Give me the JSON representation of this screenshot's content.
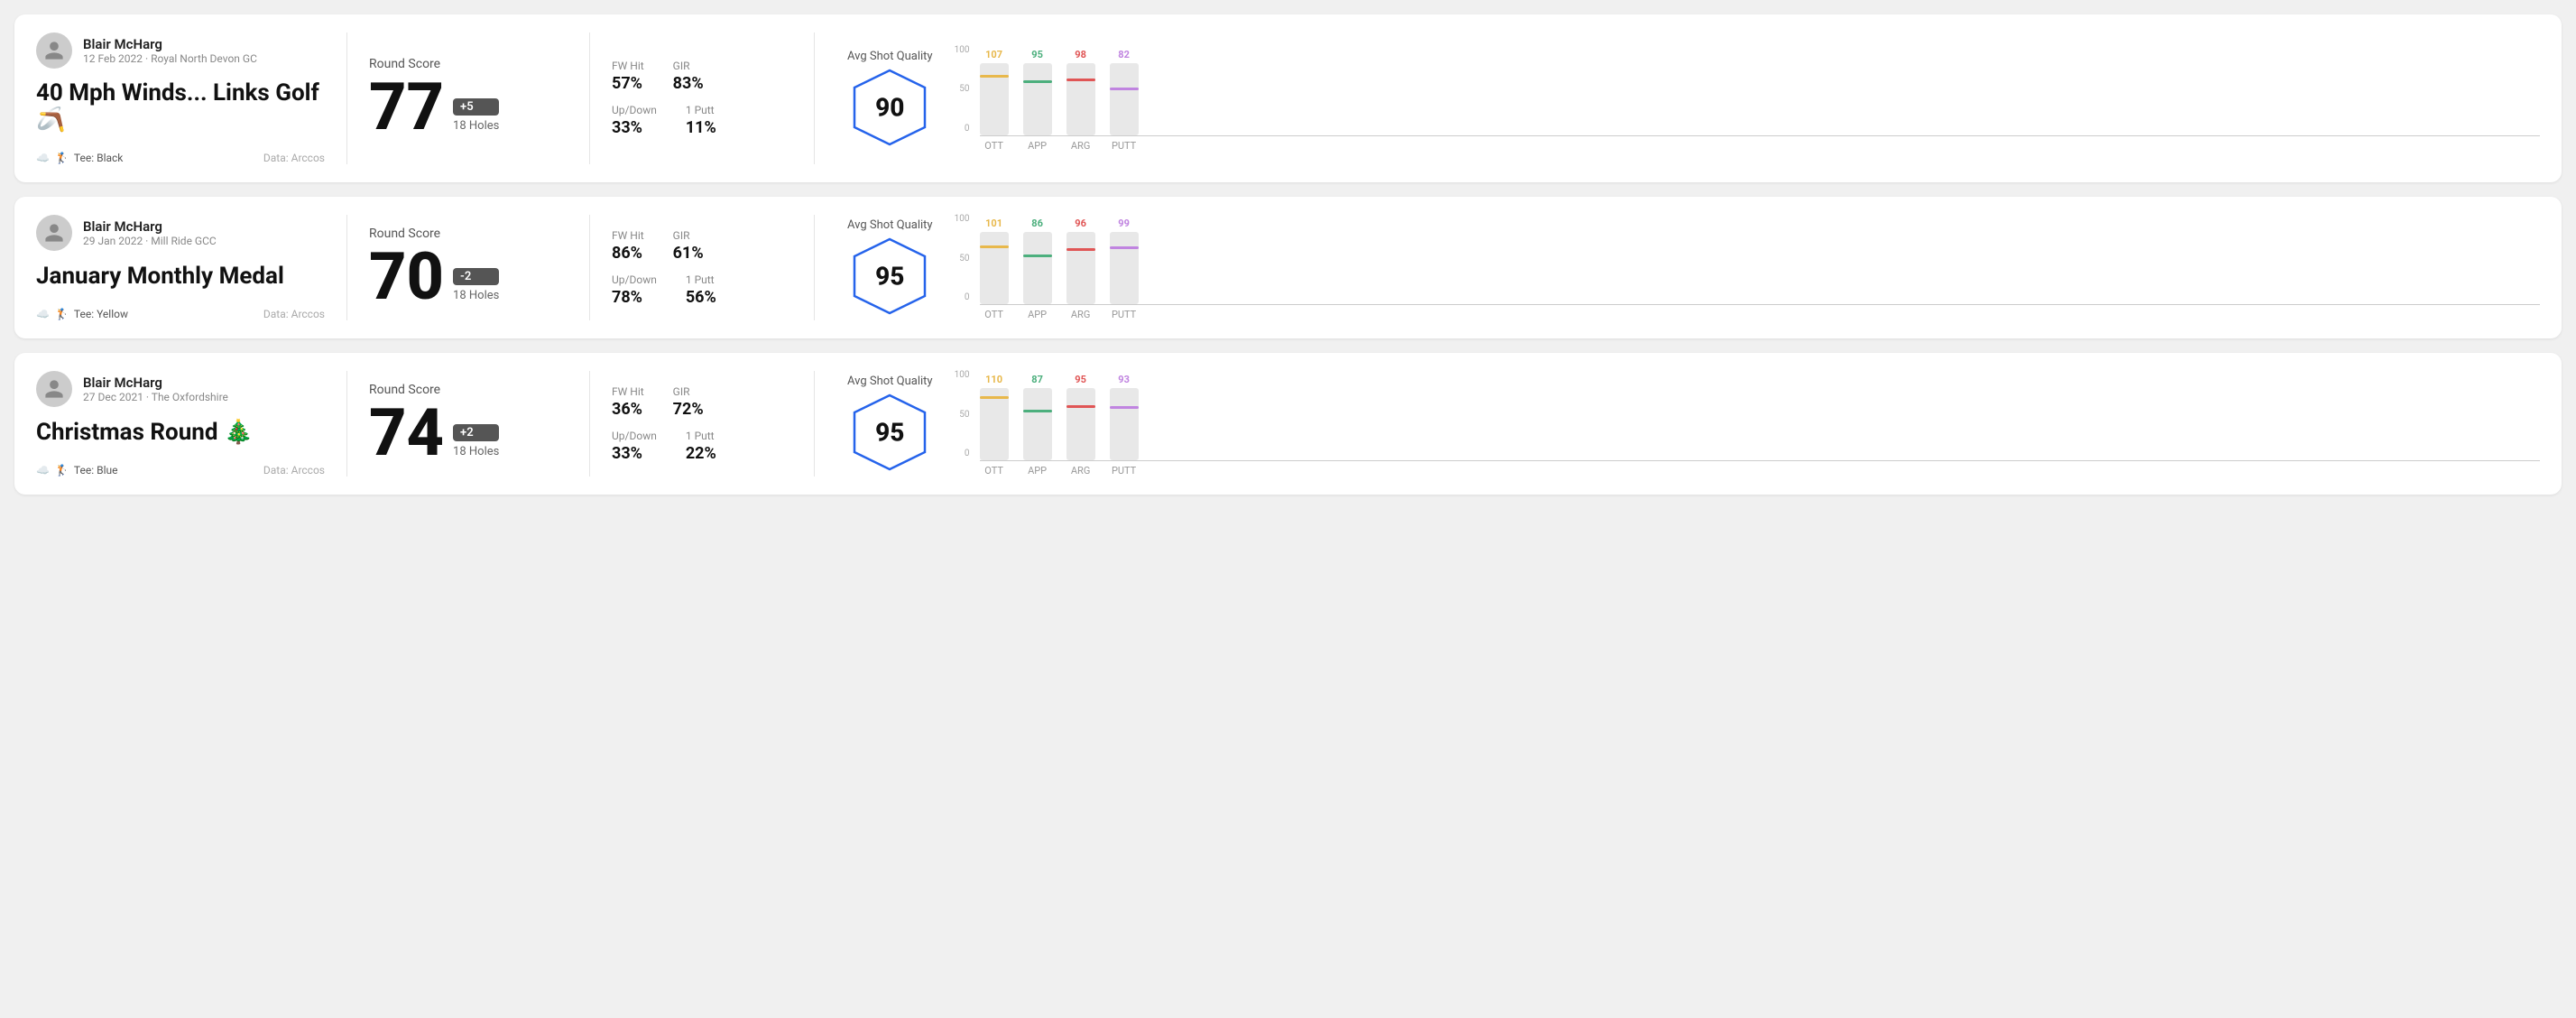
{
  "rounds": [
    {
      "id": "round-1",
      "user": {
        "name": "Blair McHarg",
        "meta": "12 Feb 2022 · Royal North Devon GC"
      },
      "title": "40 Mph Winds... Links Golf 🪃",
      "tee": "Black",
      "data_source": "Data: Arccos",
      "score": {
        "label": "Round Score",
        "number": "77",
        "badge": "+5",
        "badge_type": "over",
        "holes": "18 Holes"
      },
      "stats": [
        {
          "name": "FW Hit",
          "value": "57%"
        },
        {
          "name": "GIR",
          "value": "83%"
        },
        {
          "name": "Up/Down",
          "value": "33%"
        },
        {
          "name": "1 Putt",
          "value": "11%"
        }
      ],
      "quality": {
        "label": "Avg Shot Quality",
        "score": "90"
      },
      "chart": {
        "bars": [
          {
            "label": "OTT",
            "value": 107,
            "color": "#e8b84b",
            "pct": 80
          },
          {
            "label": "APP",
            "value": 95,
            "color": "#4caf7d",
            "pct": 72
          },
          {
            "label": "ARG",
            "value": 98,
            "color": "#e05555",
            "pct": 75
          },
          {
            "label": "PUTT",
            "value": 82,
            "color": "#c084e0",
            "pct": 62
          }
        ],
        "y_labels": [
          "100",
          "50",
          "0"
        ]
      }
    },
    {
      "id": "round-2",
      "user": {
        "name": "Blair McHarg",
        "meta": "29 Jan 2022 · Mill Ride GCC"
      },
      "title": "January Monthly Medal",
      "tee": "Yellow",
      "data_source": "Data: Arccos",
      "score": {
        "label": "Round Score",
        "number": "70",
        "badge": "-2",
        "badge_type": "under",
        "holes": "18 Holes"
      },
      "stats": [
        {
          "name": "FW Hit",
          "value": "86%"
        },
        {
          "name": "GIR",
          "value": "61%"
        },
        {
          "name": "Up/Down",
          "value": "78%"
        },
        {
          "name": "1 Putt",
          "value": "56%"
        }
      ],
      "quality": {
        "label": "Avg Shot Quality",
        "score": "95"
      },
      "chart": {
        "bars": [
          {
            "label": "OTT",
            "value": 101,
            "color": "#e8b84b",
            "pct": 78
          },
          {
            "label": "APP",
            "value": 86,
            "color": "#4caf7d",
            "pct": 65
          },
          {
            "label": "ARG",
            "value": 96,
            "color": "#e05555",
            "pct": 74
          },
          {
            "label": "PUTT",
            "value": 99,
            "color": "#c084e0",
            "pct": 76
          }
        ],
        "y_labels": [
          "100",
          "50",
          "0"
        ]
      }
    },
    {
      "id": "round-3",
      "user": {
        "name": "Blair McHarg",
        "meta": "27 Dec 2021 · The Oxfordshire"
      },
      "title": "Christmas Round 🎄",
      "tee": "Blue",
      "data_source": "Data: Arccos",
      "score": {
        "label": "Round Score",
        "number": "74",
        "badge": "+2",
        "badge_type": "over",
        "holes": "18 Holes"
      },
      "stats": [
        {
          "name": "FW Hit",
          "value": "36%"
        },
        {
          "name": "GIR",
          "value": "72%"
        },
        {
          "name": "Up/Down",
          "value": "33%"
        },
        {
          "name": "1 Putt",
          "value": "22%"
        }
      ],
      "quality": {
        "label": "Avg Shot Quality",
        "score": "95"
      },
      "chart": {
        "bars": [
          {
            "label": "OTT",
            "value": 110,
            "color": "#e8b84b",
            "pct": 85
          },
          {
            "label": "APP",
            "value": 87,
            "color": "#4caf7d",
            "pct": 66
          },
          {
            "label": "ARG",
            "value": 95,
            "color": "#e05555",
            "pct": 73
          },
          {
            "label": "PUTT",
            "value": 93,
            "color": "#c084e0",
            "pct": 71
          }
        ],
        "y_labels": [
          "100",
          "50",
          "0"
        ]
      }
    }
  ]
}
